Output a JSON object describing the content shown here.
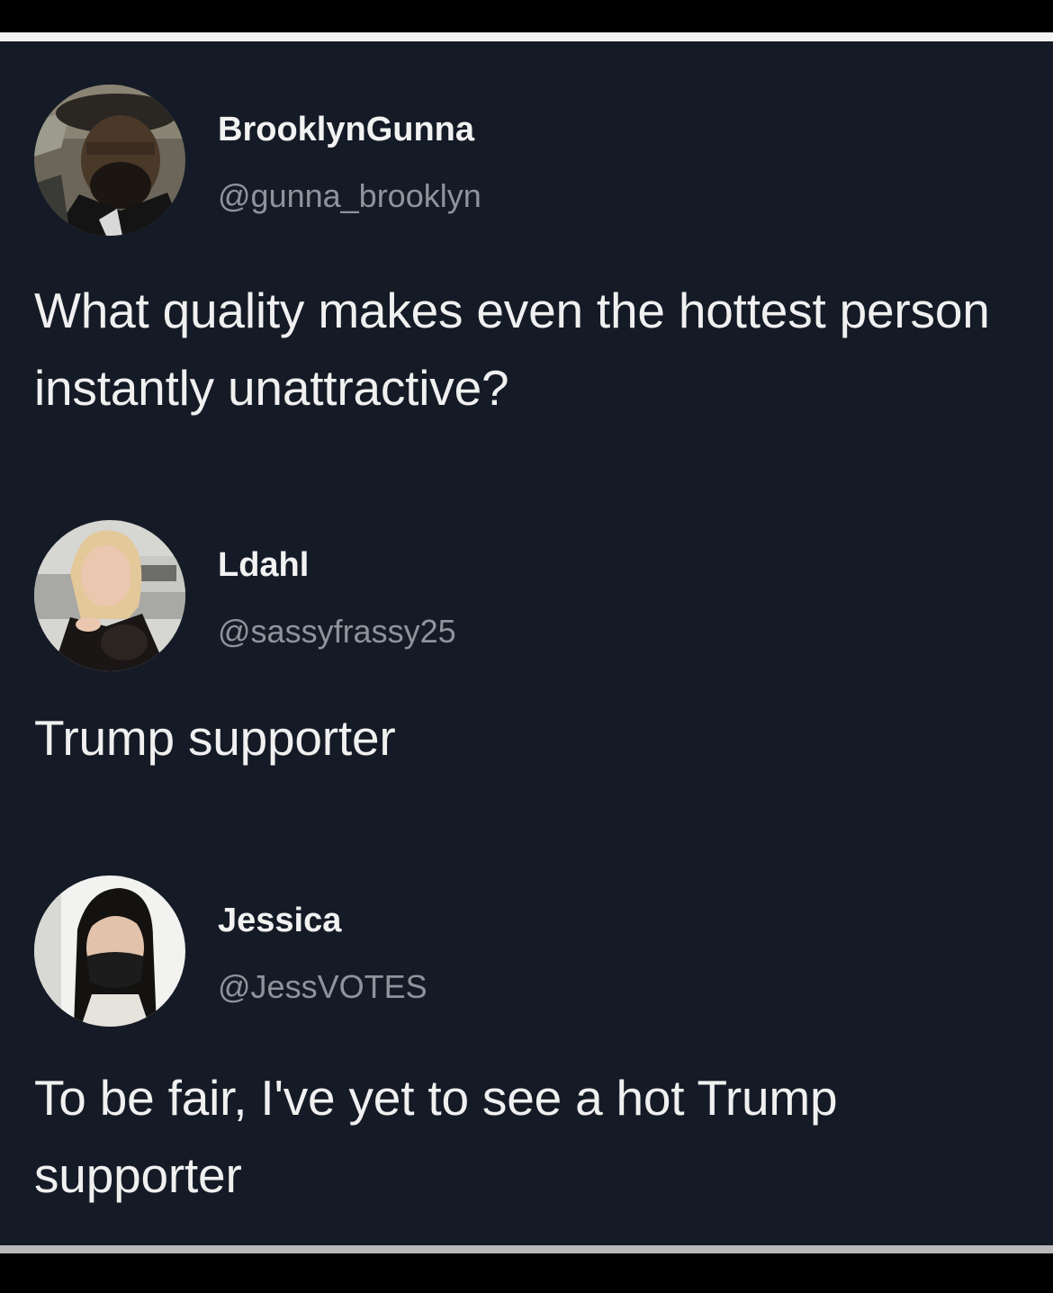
{
  "colors": {
    "background": "#151b26",
    "display_name": "#f2f2f2",
    "handle": "#8d949c",
    "text": "#f0f0f0",
    "frame": "#000000",
    "rule_top": "#f4f4f4",
    "rule_bottom": "#b9b9bb"
  },
  "tweets": [
    {
      "display_name": "BrooklynGunna",
      "handle": "@gunna_brooklyn",
      "avatar_icon": "profile-photo-man-icon",
      "text": "What quality makes even the hottest person instantly unattractive?"
    },
    {
      "display_name": "Ldahl",
      "handle": "@sassyfrassy25",
      "avatar_icon": "profile-photo-blonde-woman-icon",
      "text": "Trump supporter"
    },
    {
      "display_name": "Jessica",
      "handle": "@JessVOTES",
      "avatar_icon": "profile-photo-masked-woman-icon",
      "text": "To be fair, I've yet to see a hot Trump supporter"
    }
  ]
}
